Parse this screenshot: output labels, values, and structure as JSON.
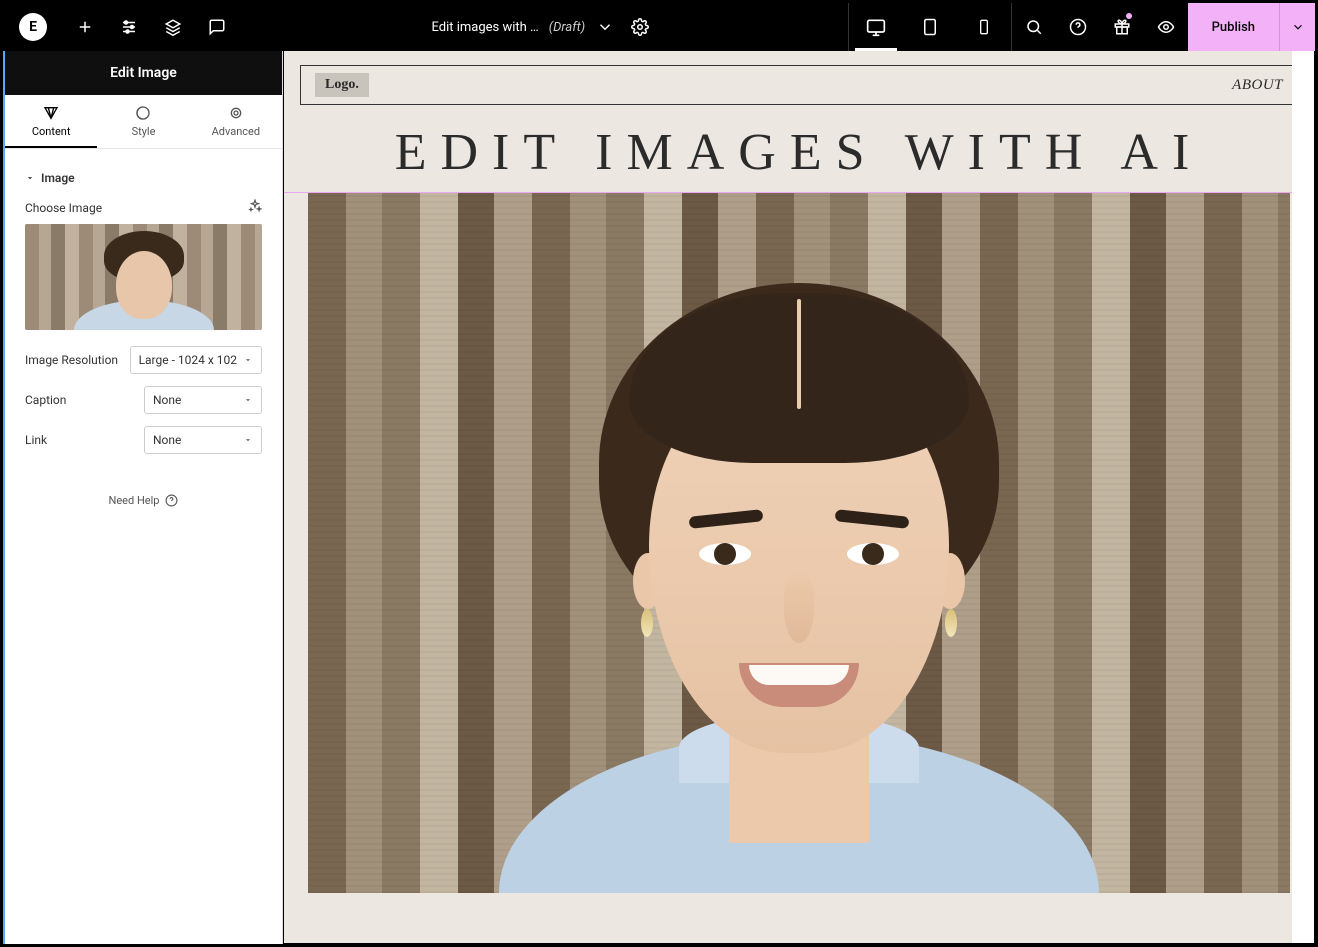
{
  "topbar": {
    "doc_title": "Edit images with …",
    "doc_status": "(Draft)",
    "publish_label": "Publish"
  },
  "sidebar": {
    "header": "Edit Image",
    "tabs": {
      "content": "Content",
      "style": "Style",
      "advanced": "Advanced"
    },
    "section_image": "Image",
    "choose_image_label": "Choose Image",
    "fields": {
      "resolution_label": "Image Resolution",
      "resolution_value": "Large - 1024 x 102",
      "caption_label": "Caption",
      "caption_value": "None",
      "link_label": "Link",
      "link_value": "None"
    },
    "need_help": "Need Help"
  },
  "canvas": {
    "logo_text": "Logo.",
    "nav_about": "ABOUT",
    "page_title": "EDIT IMAGES WITH AI"
  }
}
